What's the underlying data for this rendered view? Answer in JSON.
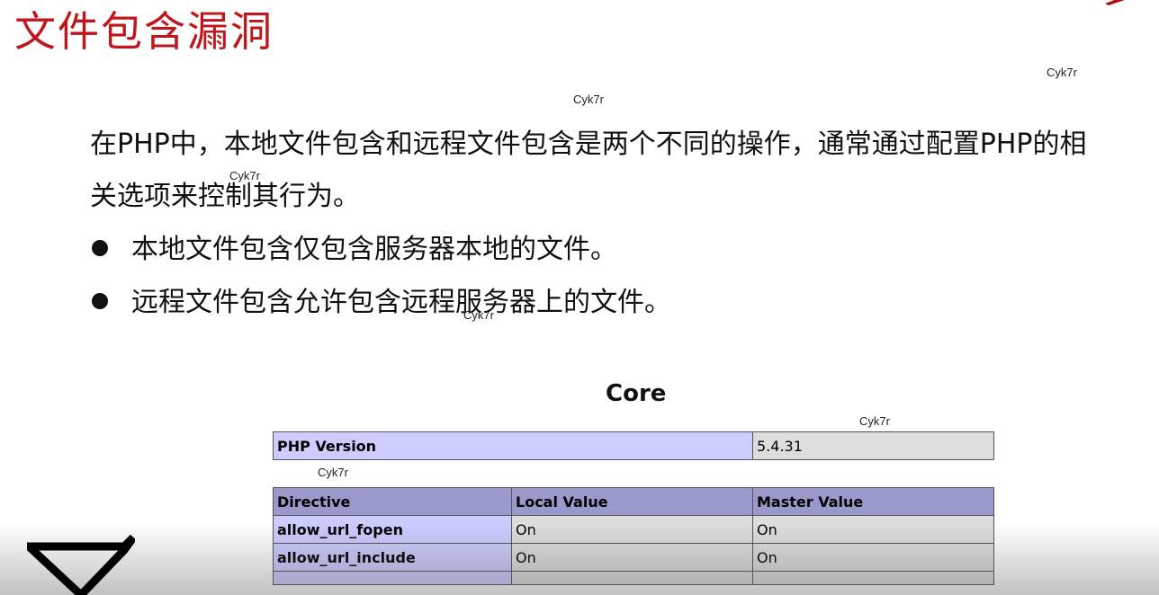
{
  "slide": {
    "title": "文件包含漏洞",
    "paragraph_line1": "在PHP中，本地文件包含和远程文件包含是两个不同的操作，通常通过配置PHP的相",
    "paragraph_line2": "关选项来控制其行为。",
    "bullets": [
      "本地文件包含仅包含服务器本地的文件。",
      "远程文件包含允许包含远程服务器上的文件。"
    ],
    "watermark": "Cyk7r",
    "title_color": "#c0161b"
  },
  "phpinfo": {
    "section_title": "Core",
    "version_label": "PHP Version",
    "version_value": "5.4.31",
    "headers": [
      "Directive",
      "Local Value",
      "Master Value"
    ],
    "rows": [
      {
        "directive": "allow_url_fopen",
        "local": "On",
        "master": "On"
      },
      {
        "directive": "allow_url_include",
        "local": "On",
        "master": "On"
      }
    ],
    "colors": {
      "header_bg": "#9999cc",
      "label_bg": "#ccccff",
      "value_bg": "#dddddd"
    }
  }
}
